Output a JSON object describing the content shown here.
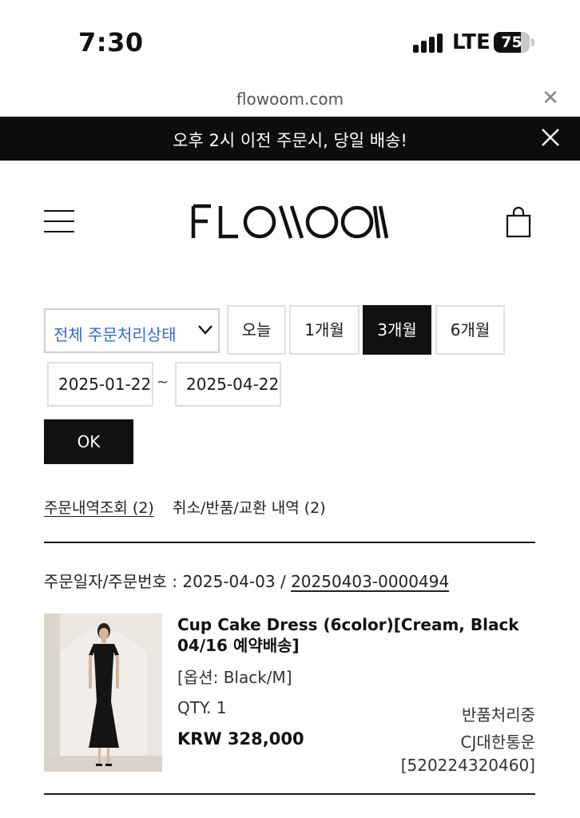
{
  "status_bar": {
    "time": "7:30",
    "network": "LTE",
    "battery": "75",
    "battery_level": 0.75
  },
  "browser": {
    "url": "flowoom.com",
    "close_icon": "close-icon"
  },
  "banner": {
    "text": "오후 2시 이전 주문시, 당일 배송!",
    "close_icon": "close-icon"
  },
  "header": {
    "menu_icon": "hamburger-menu-icon",
    "logo": "FLOWOOM",
    "cart_icon": "shopping-bag-icon"
  },
  "filters": {
    "status_select": "전체 주문처리상태",
    "periods": [
      {
        "label": "오늘",
        "active": false
      },
      {
        "label": "1개월",
        "active": false
      },
      {
        "label": "3개월",
        "active": true
      },
      {
        "label": "6개월",
        "active": false
      }
    ],
    "date_from": "2025-01-22",
    "date_to": "2025-04-22",
    "separator": "~",
    "ok_label": "OK"
  },
  "tabs": [
    {
      "label": "주문내역조회 (2)",
      "current": true
    },
    {
      "label": "취소/반품/교환 내역 (2)",
      "current": false
    }
  ],
  "order": {
    "meta_label": "주문일자/주문번호 : 2025-04-03 / ",
    "order_number": "20250403-0000494",
    "product": {
      "name": "Cup Cake Dress (6color)[Cream, Black 04/16 예약배송]",
      "option": "[옵션: Black/M]",
      "qty": "QTY. 1",
      "price": "KRW 328,000",
      "status": "반품처리중",
      "courier": "CJ대한통운",
      "tracking": "[520224320460]"
    }
  },
  "colors": {
    "banner_bg": "#0d0d0d",
    "accent_text": "#2b6cd6",
    "active_button": "#111111"
  }
}
